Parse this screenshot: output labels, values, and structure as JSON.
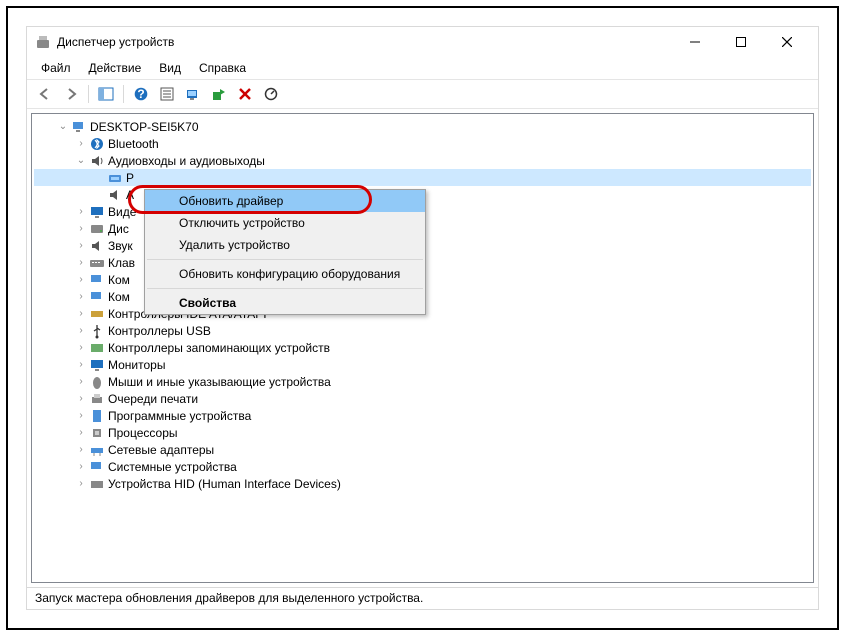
{
  "window": {
    "title": "Диспетчер устройств"
  },
  "menu": {
    "file": "Файл",
    "action": "Действие",
    "view": "Вид",
    "help": "Справка"
  },
  "tree": {
    "root": "DESKTOP-SEI5K70",
    "bluetooth": "Bluetooth",
    "audio": "Аудиовходы и аудиовыходы",
    "audio_child_r": "Р",
    "audio_child_a": "А",
    "video": "Виде",
    "disks": "Дис",
    "sound": "Звук",
    "keyboard": "Клав",
    "comp1": "Ком",
    "comp2": "Ком",
    "ide": "Контроллеры IDE ATA/ATAPI",
    "usb": "Контроллеры USB",
    "storage": "Контроллеры запоминающих устройств",
    "monitors": "Мониторы",
    "mouse": "Мыши и иные указывающие устройства",
    "print": "Очереди печати",
    "software": "Программные устройства",
    "cpu": "Процессоры",
    "net": "Сетевые адаптеры",
    "system": "Системные устройства",
    "hid": "Устройства HID (Human Interface Devices)"
  },
  "context_menu": {
    "update_driver": "Обновить драйвер",
    "disable_device": "Отключить устройство",
    "uninstall_device": "Удалить устройство",
    "scan_hardware": "Обновить конфигурацию оборудования",
    "properties": "Свойства"
  },
  "status": "Запуск мастера обновления драйверов для выделенного устройства."
}
